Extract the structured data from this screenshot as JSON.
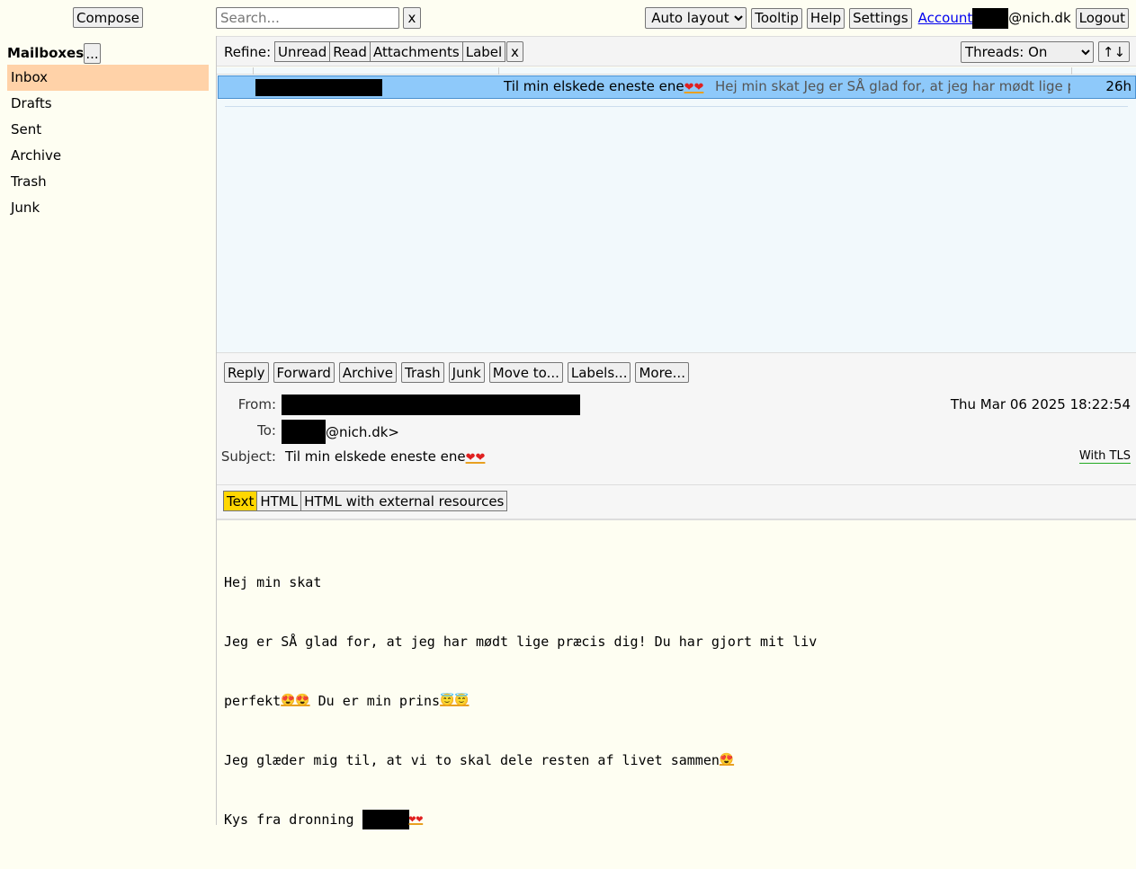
{
  "toolbar": {
    "compose": "Compose",
    "search_placeholder": "Search...",
    "search_clear": "x",
    "layout_selected": "Auto layout",
    "tooltip": "Tooltip",
    "help": "Help",
    "settings": "Settings",
    "account": "Account",
    "account_domain": "@nich.dk",
    "logout": "Logout"
  },
  "sidebar": {
    "title": "Mailboxes",
    "more": "...",
    "items": [
      {
        "label": "Inbox",
        "active": true
      },
      {
        "label": "Drafts"
      },
      {
        "label": "Sent"
      },
      {
        "label": "Archive"
      },
      {
        "label": "Trash"
      },
      {
        "label": "Junk"
      }
    ]
  },
  "refine": {
    "label": "Refine:",
    "filters": [
      "Unread",
      "Read",
      "Attachments",
      "Label"
    ],
    "clear": "x",
    "threads_selected": "Threads: On",
    "sort": "↑↓"
  },
  "message_list": [
    {
      "subject": "Til min elskede eneste ene",
      "subject_emoji": "❤❤",
      "preview": "Hej min skat Jeg er SÅ glad for, at jeg har mødt lige p",
      "age": "26h"
    }
  ],
  "message_actions": [
    "Reply",
    "Forward",
    "Archive",
    "Trash",
    "Junk",
    "Move to...",
    "Labels...",
    "More..."
  ],
  "message": {
    "from_label": "From:",
    "to_label": "To:",
    "to_domain": "@nich.dk>",
    "subject_label": "Subject:",
    "subject": "Til min elskede eneste ene",
    "subject_emoji": "❤❤",
    "date": "Thu Mar 06 2025 18:22:54",
    "tls": "With TLS"
  },
  "view_modes": {
    "selected": "Text",
    "options": [
      "Text",
      "HTML",
      "HTML with external resources"
    ]
  },
  "body": {
    "line1": "Hej min skat",
    "line2": "Jeg er SÅ glad for, at jeg har mødt lige præcis dig! Du har gjort mit liv",
    "line3_a": "perfekt",
    "line3_emoji": "😍😍",
    "line3_b": " Du er min prins",
    "line3_emoji2": "😇😇",
    "line4": "Jeg glæder mig til, at vi to skal dele resten af livet sammen",
    "line4_emoji": "😍",
    "line5": "Kys fra dronning ",
    "line5_emoji": "❤❤"
  }
}
